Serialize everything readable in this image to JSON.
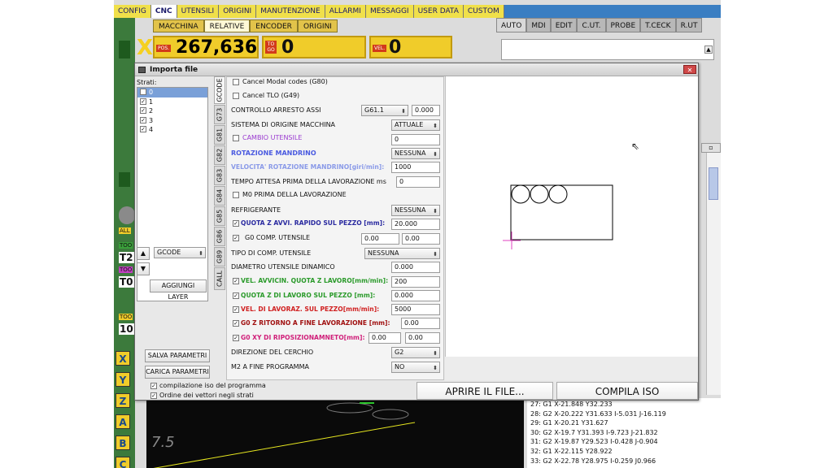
{
  "menu": [
    "CONFIG",
    "CNC",
    "UTENSILI",
    "ORIGINI",
    "MANUTENZIONE",
    "ALLARMI",
    "MESSAGGI",
    "USER DATA",
    "CUSTOM"
  ],
  "subtabs": [
    "MACCHINA",
    "RELATIVE",
    "ENCODER",
    "ORIGINI"
  ],
  "axis": {
    "letter": "X",
    "pos_tag": "POS.",
    "position": "267,636",
    "togo_tag": "TO GO",
    "togo": "0",
    "vel_tag": "VEL.",
    "vel": "0"
  },
  "right_tabs": [
    "AUTO",
    "MDI",
    "EDIT",
    "C.UT.",
    "PROBE",
    "T.CECK",
    "R.UT"
  ],
  "side_labels": {
    "all": "ALL",
    "tool1": "TOO",
    "t2": "T2",
    "tool2": "TOO",
    "t0": "T0",
    "tool3": "TOO",
    "n10": "10"
  },
  "axis_buttons": [
    "X",
    "Y",
    "Z",
    "A",
    "B",
    "C"
  ],
  "gcode_lines": [
    "27:  G1 X-21.848 Y32.233",
    "28:  G2 X-20.222 Y31.633 I-5.031 J-16.119",
    "29:  G1 X-20.21 Y31.627",
    "30:  G2 X-19.7 Y31.393 I-9.723 J-21.832",
    "31:  G2 X-19.87 Y29.523 I-0.428 J-0.904",
    "32:  G1 X-22.115 Y28.922",
    "33:  G2 X-22.78 Y28.975 I-0.259 J0.966"
  ],
  "dialog": {
    "title": "Importa file",
    "layers_label": "Strati:",
    "layers": [
      "0",
      "1",
      "2",
      "3",
      "4"
    ],
    "layer_combo": "GCODE",
    "add_layer": "AGGIUNGI LAYER",
    "save_params": "SALVA PARAMETRI",
    "load_params": "CARICA PARAMETRI",
    "compile_iso": "compilazione iso del programma",
    "vector_order": "Ordine dei vettori negli strati",
    "vtabs": [
      "GCODE",
      "G73",
      "G81",
      "G82",
      "G83",
      "G84",
      "G85",
      "G86",
      "G89",
      "CALL"
    ],
    "rows": {
      "cancel_modal": "Cancel Modal codes (G80)",
      "cancel_tlo": "Cancel TLO (G49)",
      "controllo_label": "CONTROLLO ARRESTO ASSI",
      "controllo_combo": "G61.1",
      "controllo_value": "0.000",
      "sistema_label": "SISTEMA DI ORIGINE MACCHINA",
      "sistema_combo": "ATTUALE",
      "cambio_label": "CAMBIO UTENSILE",
      "cambio_value": "0",
      "rotazione_label": "ROTAZIONE MANDRINO",
      "rotazione_combo": "NESSUNA",
      "velocita_label": "VELOCITA' ROTAZIONE MANDRINO[giri/min]:",
      "velocita_value": "1000",
      "tempo_label": "TEMPO ATTESA PRIMA DELLA LAVORAZIONE ms",
      "tempo_value": "0",
      "m0_label": "M0 PRIMA DELLA LAVORAZIONE",
      "refrig_label": "REFRIGERANTE",
      "refrig_combo": "NESSUNA",
      "quota_rapido_label": "QUOTA Z AVVI. RAPIDO SUL PEZZO [mm]:",
      "quota_rapido_value": "20.000",
      "g0comp_label": "G0 COMP. UTENSILE",
      "g0comp_v1": "0.00",
      "g0comp_v2": "0.00",
      "tipo_comp_label": "TIPO DI COMP. UTENSILE",
      "tipo_comp_combo": "NESSUNA",
      "diametro_label": "DIAMETRO UTENSILE DINAMICO",
      "diametro_value": "0.000",
      "vel_avvic_label": "VEL. AVVICIN. QUOTA Z LAVORO[mm/min]:",
      "vel_avvic_value": "200",
      "quota_lavoro_label": "QUOTA Z DI LAVORO SUL PEZZO [mm]:",
      "quota_lavoro_value": "0.000",
      "vel_lavoraz_label": "VEL. DI LAVORAZ. SUL PEZZO[mm/min]:",
      "vel_lavoraz_value": "5000",
      "g0z_label": "G0 Z RITORNO A FINE LAVORAZIONE [mm]:",
      "g0z_value": "0.00",
      "g0xy_label": "G0 XY DI RIPOSIZIONAMNETO[mm]:",
      "g0xy_v1": "0.00",
      "g0xy_v2": "0.00",
      "direzione_label": "DIREZIONE DEL CERCHIO",
      "direzione_combo": "G2",
      "m2_label": "M2 A FINE PROGRAMMA",
      "m2_combo": "NO"
    },
    "open_file": "APRIRE IL FILE...",
    "compile_btn": "COMPILA ISO"
  },
  "colors": {
    "blue_label": "#2a2aa0",
    "purple_label": "#9a3ad0",
    "light_blue_label": "#8a9ae8",
    "rotazione_blue": "#4a5ae0",
    "green_label": "#2a9a2a",
    "red_label": "#d02020",
    "dark_red_label": "#a01010",
    "magenta_label": "#d0207a",
    "menu_yellow": "#f0e04a",
    "cursor_magenta": "#e040c0"
  }
}
